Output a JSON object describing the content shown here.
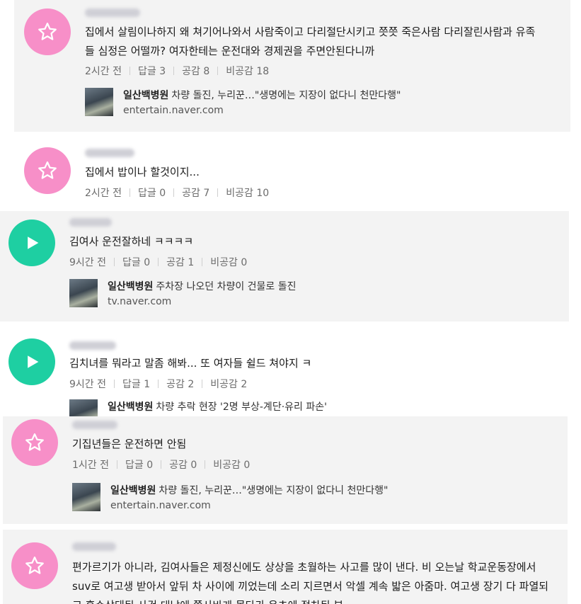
{
  "comments": [
    {
      "text": "집에서 살림이나하지 왜 쳐기어나와서 사람죽이고 다리절단시키고 쯧쯧 죽은사람 다리잘린사람과 유족들 심정은 어떨까? 여자한테는 운전대와 경제권을 주면안된다니까",
      "time": "2시간 전",
      "reply": "답글 3",
      "like": "공감 8",
      "dislike": "비공감 18",
      "link": {
        "source": "일산백병원",
        "headline": "차량 돌진, 누리꾼…\"생명에는 지장이 없다니 천만다행\"",
        "url": "entertain.naver.com"
      },
      "avatar_icon": "star-icon"
    },
    {
      "text": "집에서 밥이나 할것이지...",
      "time": "2시간 전",
      "reply": "답글 0",
      "like": "공감 7",
      "dislike": "비공감 10",
      "avatar_icon": "star-icon"
    },
    {
      "text": "김여사 운전잘하네 ㅋㅋㅋㅋ",
      "time": "9시간 전",
      "reply": "답글 0",
      "like": "공감 1",
      "dislike": "비공감 0",
      "link": {
        "source": "일산백병원",
        "headline": "주차장 나오던 차량이 건물로 돌진",
        "url": "tv.naver.com"
      },
      "avatar_icon": "play-icon"
    },
    {
      "text": "김치녀를 뭐라고 말좀 해봐... 또 여자들 쉴드 쳐야지 ㅋ",
      "time": "9시간 전",
      "reply": "답글 1",
      "like": "공감 2",
      "dislike": "비공감 2",
      "link": {
        "source": "일산백병원",
        "headline": "차량 추락 현장 '2명 부상-계단·유리 파손'"
      },
      "avatar_icon": "play-icon"
    },
    {
      "text": "기집년들은 운전하면 안됨",
      "time": "1시간 전",
      "reply": "답글 0",
      "like": "공감 0",
      "dislike": "비공감 0",
      "link": {
        "source": "일산백병원",
        "headline": "차량 돌진, 누리꾼…\"생명에는 지장이 없다니 천만다행\"",
        "url": "entertain.naver.com"
      },
      "avatar_icon": "star-icon"
    },
    {
      "text": "편가르기가 아니라, 김여사들은 제정신에도 상상을 초월하는 사고를 많이 낸다. 비 오는날 학교운동장에서 suv로 여고생 받아서 앞뒤 차 사이에 끼었는데 소리 지르면서 악셀 계속 밟은 아줌마. 여고생 장기 다 파열되고 혼수상태된 사건 대낮에 쫌사바게 몰다가 은츠에 정차된 부",
      "avatar_icon": "star-icon"
    }
  ],
  "colors": {
    "pink_avatar": "#f78fc8",
    "teal_avatar": "#1ecfa2",
    "card_gray": "#f3f3f3"
  }
}
